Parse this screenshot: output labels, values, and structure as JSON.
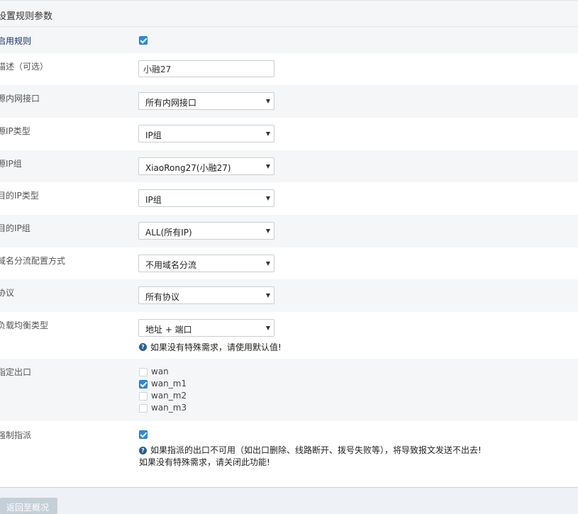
{
  "header": {
    "title": "设置规则参数"
  },
  "fields": {
    "enable": {
      "label": "启用规则",
      "checked": true
    },
    "description": {
      "label": "描述（可选）",
      "value": "小融27"
    },
    "source_interface": {
      "label": "源内网接口",
      "value": "所有内网接口"
    },
    "source_ip_type": {
      "label": "源IP类型",
      "value": "IP组"
    },
    "source_ip_group": {
      "label": "源IP组",
      "value": "XiaoRong27(小融27)"
    },
    "dest_ip_type": {
      "label": "目的IP类型",
      "value": "IP组"
    },
    "dest_ip_group": {
      "label": "目的IP组",
      "value": "ALL(所有IP)"
    },
    "domain_mode": {
      "label": "域名分流配置方式",
      "value": "不用域名分流"
    },
    "protocol": {
      "label": "协议",
      "value": "所有协议"
    },
    "balance_type": {
      "label": "负载均衡类型",
      "value": "地址 + 端口",
      "help_icon": "help-icon",
      "help": "如果没有特殊需求，请使用默认值!"
    },
    "outlet": {
      "label": "指定出口",
      "options": [
        {
          "name": "wan",
          "checked": false
        },
        {
          "name": "wan_m1",
          "checked": true
        },
        {
          "name": "wan_m2",
          "checked": false
        },
        {
          "name": "wan_m3",
          "checked": false
        }
      ]
    },
    "force": {
      "label": "强制指派",
      "checked": true,
      "help_line1": "如果指派的出口不可用（如出口删除、线路断开、拨号失败等），将导致报文发送不出去!",
      "help_line2": "如果没有特殊需求，请关闭此功能!"
    }
  },
  "footer": {
    "back_label": "返回至概况"
  },
  "colors": {
    "accent": "#2c8ae0",
    "help": "#275d97",
    "row_alt": "#f4f6f7"
  }
}
